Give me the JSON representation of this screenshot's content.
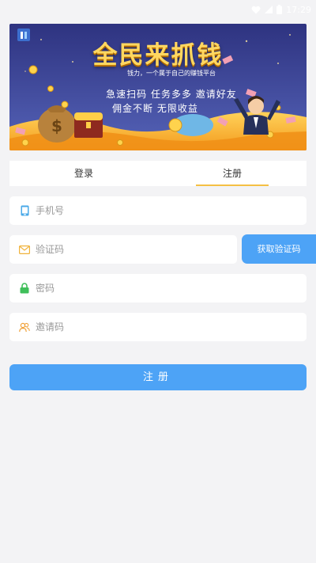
{
  "status_bar": {
    "time": "17:29"
  },
  "banner": {
    "title": "全民来抓钱",
    "subtitle": "钱力，一个属于自己的赚钱平台",
    "line1": "急速扫码  任务多多  邀请好友",
    "line2": "佣金不断  无限收益"
  },
  "tabs": [
    {
      "label": "登录",
      "active": false
    },
    {
      "label": "注册",
      "active": true
    }
  ],
  "form": {
    "phone_placeholder": "手机号",
    "code_placeholder": "验证码",
    "password_placeholder": "密码",
    "invite_placeholder": "邀请码",
    "get_code_label": "获取验证码",
    "submit_label": "注册"
  },
  "colors": {
    "background": "#f3f3f5",
    "accent_blue": "#4da3f6",
    "tab_underline": "#f5c044",
    "banner_sky": "#3a3f8f",
    "banner_gold": "#f6b22b"
  },
  "icons": {
    "phone": "phone-icon",
    "code": "envelope-icon",
    "password": "lock-icon",
    "invite": "people-icon",
    "logo": "app-logo-icon"
  }
}
